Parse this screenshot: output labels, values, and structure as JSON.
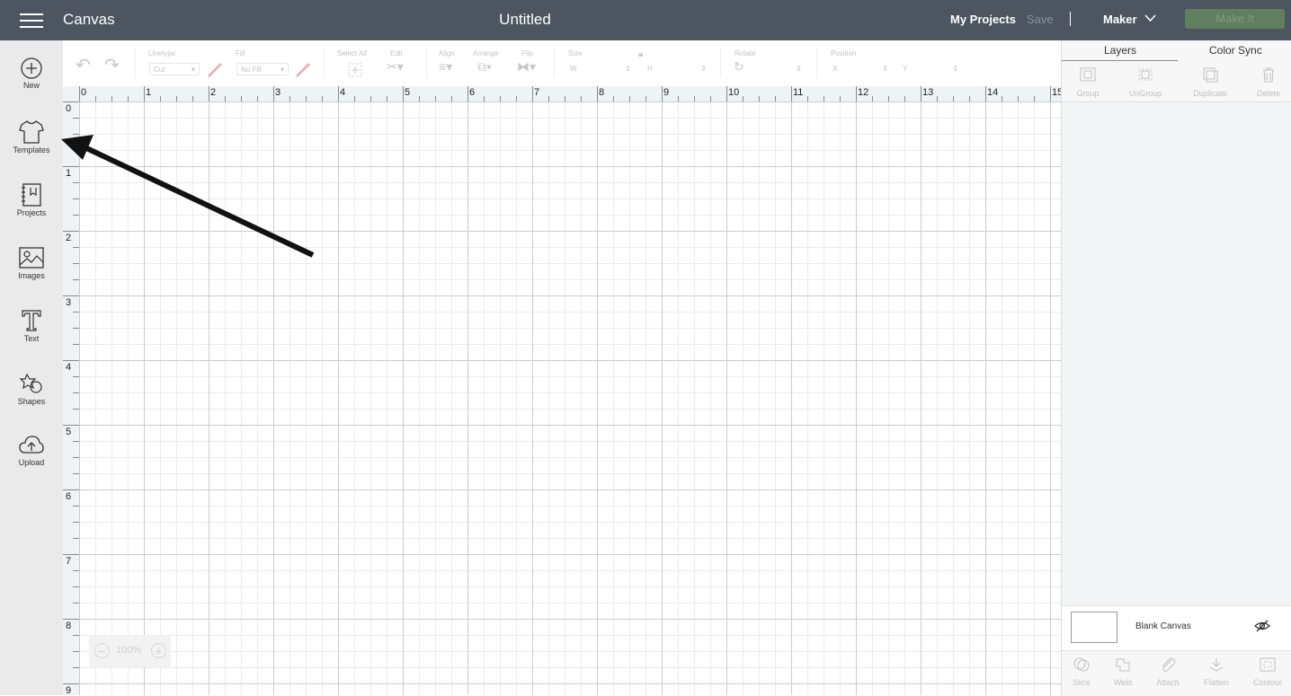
{
  "header": {
    "app_title": "Canvas",
    "doc_title": "Untitled",
    "my_projects": "My Projects",
    "save": "Save",
    "machine": "Maker",
    "make_it": "Make It"
  },
  "sidebar": {
    "items": [
      {
        "label": "New",
        "icon": "plus-circle-icon"
      },
      {
        "label": "Templates",
        "icon": "tshirt-icon"
      },
      {
        "label": "Projects",
        "icon": "notebook-icon"
      },
      {
        "label": "Images",
        "icon": "image-icon"
      },
      {
        "label": "Text",
        "icon": "text-t-icon"
      },
      {
        "label": "Shapes",
        "icon": "shapes-icon"
      },
      {
        "label": "Upload",
        "icon": "cloud-upload-icon"
      }
    ]
  },
  "toolbar": {
    "linetype_label": "Linetype",
    "linetype_value": "Cut",
    "fill_label": "Fill",
    "fill_value": "No Fill",
    "select_all_label": "Select All",
    "edit_label": "Edit",
    "align_label": "Align",
    "arrange_label": "Arrange",
    "flip_label": "Flip",
    "size_label": "Size",
    "size_w": "W",
    "size_h": "H",
    "rotate_label": "Rotate",
    "position_label": "Position",
    "position_x": "X",
    "position_y": "Y"
  },
  "ruler": {
    "horizontal": [
      "0",
      "1",
      "2",
      "3",
      "4",
      "5",
      "6",
      "7",
      "8",
      "9",
      "10",
      "11",
      "12",
      "13",
      "14",
      "15"
    ],
    "vertical": [
      "0",
      "1",
      "2",
      "3",
      "4",
      "5",
      "6",
      "7",
      "8",
      "9"
    ]
  },
  "zoom": {
    "value": "100%",
    "minus": "−",
    "plus": "+"
  },
  "layers_panel": {
    "tabs": [
      "Layers",
      "Color Sync"
    ],
    "actions": [
      "Group",
      "UnGroup",
      "Duplicate",
      "Delete"
    ],
    "blank_canvas": "Blank Canvas",
    "bottom_actions": [
      "Slice",
      "Weld",
      "Attach",
      "Flatten",
      "Contour"
    ]
  },
  "colors": {
    "topbar": "#4c5560",
    "make_it_button": "#5f7f5f",
    "sidebar": "#eaeaea",
    "panel": "#f1f5f5"
  }
}
